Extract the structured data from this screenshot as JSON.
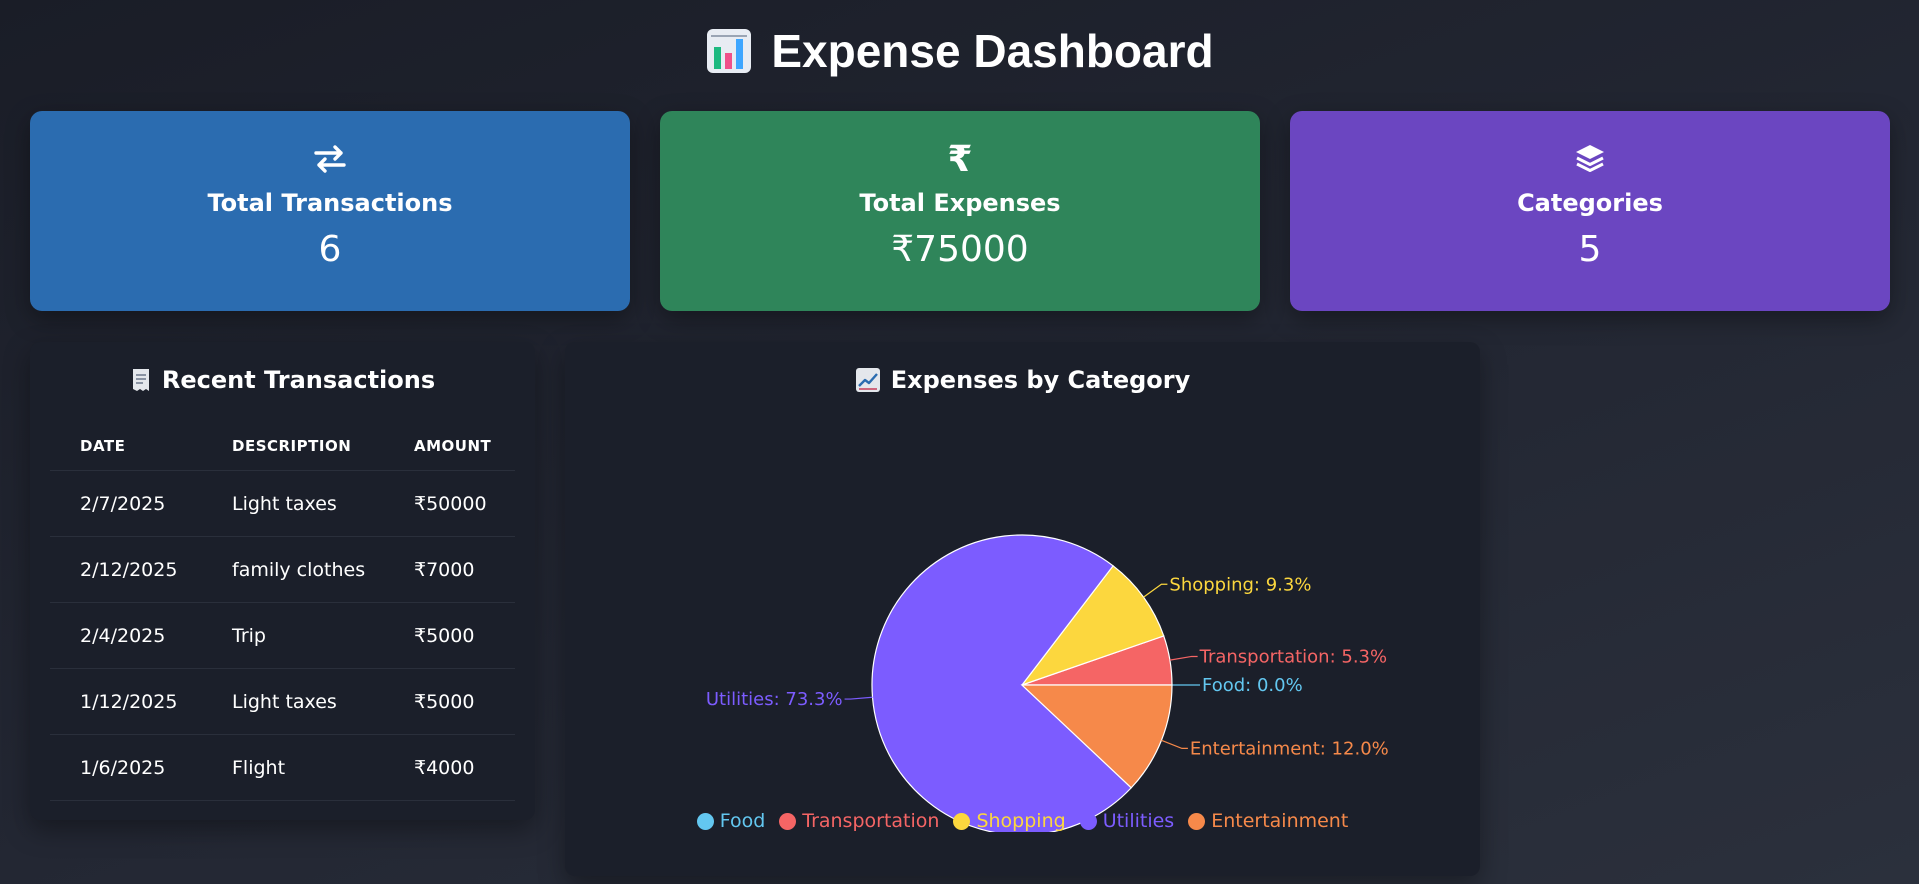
{
  "page": {
    "title": "Expense Dashboard",
    "title_icon": "bar-chart-icon"
  },
  "cards": [
    {
      "icon": "arrows-exchange-icon",
      "label": "Total Transactions",
      "value": "6",
      "color": "#2b6cb0"
    },
    {
      "icon": "rupee-icon",
      "icon_text": "₹",
      "label": "Total Expenses",
      "value": "₹75000",
      "color": "#2f855a"
    },
    {
      "icon": "layers-icon",
      "label": "Categories",
      "value": "5",
      "color": "#6b46c1"
    }
  ],
  "transactions": {
    "title": "Recent Transactions",
    "icon": "receipt-icon",
    "columns": [
      "DATE",
      "DESCRIPTION",
      "AMOUNT"
    ],
    "rows": [
      [
        "2/7/2025",
        "Light taxes",
        "₹50000"
      ],
      [
        "2/12/2025",
        "family clothes",
        "₹7000"
      ],
      [
        "2/4/2025",
        "Trip",
        "₹5000"
      ],
      [
        "1/12/2025",
        "Light taxes",
        "₹5000"
      ],
      [
        "1/6/2025",
        "Flight",
        "₹4000"
      ]
    ]
  },
  "chart": {
    "title": "Expenses by Category",
    "icon": "trending-up-icon"
  },
  "chart_data": {
    "type": "pie",
    "title": "Expenses by Category",
    "slices": [
      {
        "name": "Food",
        "percent": 0.0,
        "label": "Food: 0.0%",
        "color": "#63c7f0"
      },
      {
        "name": "Transportation",
        "percent": 5.3,
        "label": "Transportation: 5.3%",
        "color": "#f56565"
      },
      {
        "name": "Shopping",
        "percent": 9.3,
        "label": "Shopping: 9.3%",
        "color": "#fcd73e"
      },
      {
        "name": "Utilities",
        "percent": 73.3,
        "label": "Utilities: 73.3%",
        "color": "#7c5cff"
      },
      {
        "name": "Entertainment",
        "percent": 12.0,
        "label": "Entertainment: 12.0%",
        "color": "#f6894a"
      }
    ],
    "legend": [
      "Food",
      "Transportation",
      "Shopping",
      "Utilities",
      "Entertainment"
    ],
    "legend_position": "bottom"
  }
}
